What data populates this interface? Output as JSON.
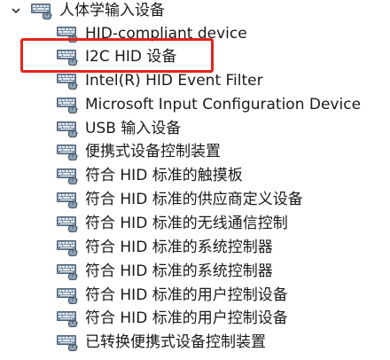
{
  "category": {
    "label": "人体学输入设备",
    "expanded": true,
    "chevron_icon": "chevron-down-icon",
    "icon": "hid-device-icon"
  },
  "devices": [
    {
      "label": "HID-compliant device",
      "icon": "hid-device-icon"
    },
    {
      "label": "I2C HID 设备",
      "icon": "hid-device-icon",
      "highlighted": true
    },
    {
      "label": "Intel(R) HID Event Filter",
      "icon": "hid-device-icon"
    },
    {
      "label": "Microsoft Input Configuration Device",
      "icon": "hid-device-icon"
    },
    {
      "label": "USB 输入设备",
      "icon": "hid-device-icon"
    },
    {
      "label": "便携式设备控制装置",
      "icon": "hid-device-icon"
    },
    {
      "label": "符合 HID 标准的触摸板",
      "icon": "hid-device-icon"
    },
    {
      "label": "符合 HID 标准的供应商定义设备",
      "icon": "hid-device-icon"
    },
    {
      "label": "符合 HID 标准的无线通信控制",
      "icon": "hid-device-icon"
    },
    {
      "label": "符合 HID 标准的系统控制器",
      "icon": "hid-device-icon"
    },
    {
      "label": "符合 HID 标准的系统控制器",
      "icon": "hid-device-icon"
    },
    {
      "label": "符合 HID 标准的用户控制设备",
      "icon": "hid-device-icon"
    },
    {
      "label": "符合 HID 标准的用户控制设备",
      "icon": "hid-device-icon"
    },
    {
      "label": "已转换便携式设备控制装置",
      "icon": "hid-device-icon"
    }
  ],
  "colors": {
    "highlight_border": "#e3241b",
    "icon_body": "#5b6f86",
    "icon_keys": "#e7edf3"
  }
}
